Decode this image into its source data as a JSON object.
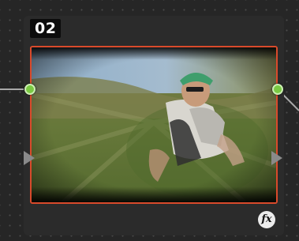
{
  "node": {
    "label": "02",
    "fx_badge": "fx"
  },
  "colors": {
    "canvas_bg": "#262626",
    "node_bg": "#2b2b2b",
    "selection_border": "#d94a2b",
    "port_green": "#7ac943",
    "triangle_gray": "#8a8a8a"
  },
  "icons": {
    "input_port": "green-circle",
    "output_port": "green-circle",
    "rgb_input": "gray-triangle",
    "rgb_output": "gray-triangle",
    "effect_badge": "fx-icon"
  }
}
